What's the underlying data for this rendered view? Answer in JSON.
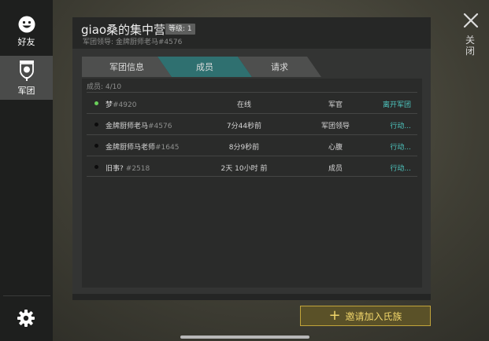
{
  "sidebar": {
    "friends_label": "好友",
    "clan_label": "军团"
  },
  "close_label": "关闭",
  "clan": {
    "name": "giao桑的集中营",
    "level": "等级: 1",
    "leader_line": "军团领导: 金牌厨师老马#4576"
  },
  "tabs": [
    {
      "label": "军团信息",
      "active": false
    },
    {
      "label": "成员",
      "active": true
    },
    {
      "label": "请求",
      "active": false
    }
  ],
  "members_count": "成员: 4/10",
  "members": [
    {
      "name": "梦",
      "tag": "#4920",
      "online": true,
      "status": "在线",
      "rank": "军官",
      "action": "离开军团"
    },
    {
      "name": "金牌厨师老马",
      "tag": "#4576",
      "online": false,
      "status": "7分44秒前",
      "rank": "军团领导",
      "action": "行动..."
    },
    {
      "name": "金牌厨师马老师",
      "tag": "#1645",
      "online": false,
      "status": "8分9秒前",
      "rank": "心腹",
      "action": "行动..."
    },
    {
      "name": "旧事?",
      "tag": "#2518",
      "online": false,
      "status": "2天 10小时 前",
      "rank": "成员",
      "action": "行动..."
    }
  ],
  "invite_button": {
    "icon": "+",
    "label": "邀请加入氏族"
  },
  "colors": {
    "accent": "#4ec7c0",
    "active_tab": "#2f7070",
    "online": "#6ad05a",
    "invite_text": "#f0d56a"
  }
}
